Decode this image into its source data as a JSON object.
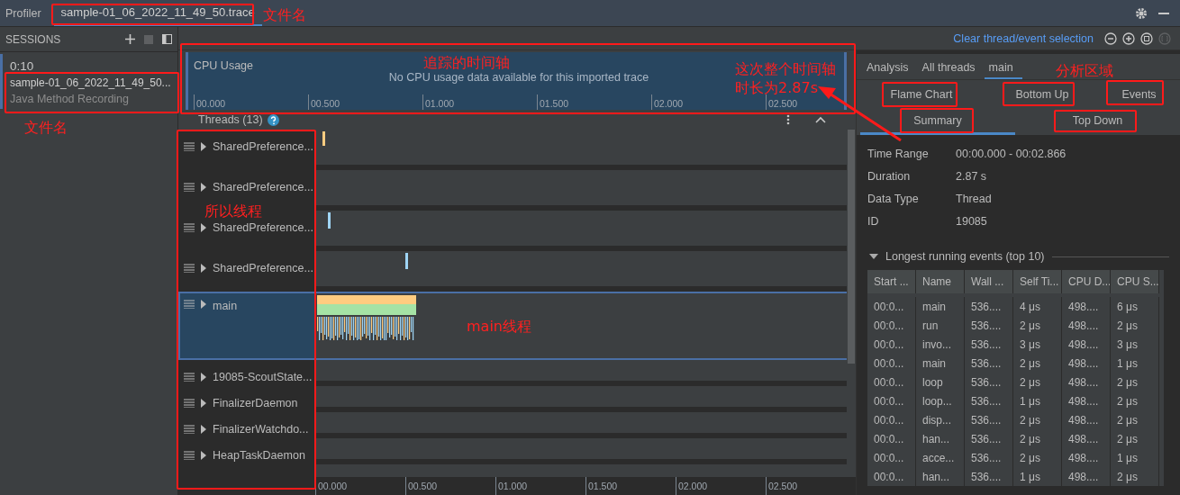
{
  "top_bar": {
    "title": "Profiler",
    "tabs": [
      {
        "label": "sample-01_06_2022_11_49_50.trace",
        "selected": true
      }
    ]
  },
  "sessions": {
    "title": "SESSIONS",
    "items": [
      {
        "time": "0:10",
        "name": "sample-01_06_2022_11_49_50...",
        "type": "Java Method Recording",
        "selected": true
      }
    ]
  },
  "toolbar": {
    "link": "Clear thread/event selection"
  },
  "cpu_usage": {
    "title": "CPU Usage",
    "message": "No CPU usage data available for this imported trace",
    "axis": [
      "00.000",
      "00.500",
      "01.000",
      "01.500",
      "02.000",
      "02.500"
    ]
  },
  "threads": {
    "title": "Threads (13)",
    "items": [
      {
        "name": "SharedPreference...",
        "selected": false
      },
      {
        "name": "SharedPreference...",
        "selected": false
      },
      {
        "name": "SharedPreference...",
        "selected": false
      },
      {
        "name": "SharedPreference...",
        "selected": false
      },
      {
        "name": "main",
        "selected": true
      },
      {
        "name": "19085-ScoutState...",
        "selected": false
      },
      {
        "name": "FinalizerDaemon",
        "selected": false
      },
      {
        "name": "FinalizerWatchdo...",
        "selected": false
      },
      {
        "name": "HeapTaskDaemon",
        "selected": false
      }
    ],
    "axis": [
      "00.000",
      "00.500",
      "01.000",
      "01.500",
      "02.000",
      "02.500"
    ]
  },
  "analysis": {
    "tabs": [
      {
        "label": "Analysis",
        "selected": false
      },
      {
        "label": "All threads",
        "selected": false
      },
      {
        "label": "main",
        "selected": true
      }
    ],
    "views": [
      {
        "label": "Flame Chart",
        "selected": false
      },
      {
        "label": "Bottom Up",
        "selected": false
      },
      {
        "label": "Events",
        "selected": false
      },
      {
        "label": "Summary",
        "selected": true
      },
      {
        "label": "Top Down",
        "selected": false
      }
    ],
    "summary": [
      {
        "label": "Time Range",
        "value": "00:00.000 - 00:02.866"
      },
      {
        "label": "Duration",
        "value": "2.87 s"
      },
      {
        "label": "Data Type",
        "value": "Thread"
      },
      {
        "label": "ID",
        "value": "19085"
      }
    ],
    "events": {
      "title": "Longest running events (top 10)",
      "expanded": true,
      "columns": [
        "Start ...",
        "Name",
        "Wall ...",
        "Self Ti...",
        "CPU D...",
        "CPU S..."
      ],
      "rows": [
        [
          "00:0...",
          "main",
          "536....",
          "4 μs",
          "498....",
          "6 μs"
        ],
        [
          "00:0...",
          "run",
          "536....",
          "2 μs",
          "498....",
          "2 μs"
        ],
        [
          "00:0...",
          "invo...",
          "536....",
          "3 μs",
          "498....",
          "3 μs"
        ],
        [
          "00:0...",
          "main",
          "536....",
          "2 μs",
          "498....",
          "1 μs"
        ],
        [
          "00:0...",
          "loop",
          "536....",
          "2 μs",
          "498....",
          "2 μs"
        ],
        [
          "00:0...",
          "loop...",
          "536....",
          "1 μs",
          "498....",
          "2 μs"
        ],
        [
          "00:0...",
          "disp...",
          "536....",
          "2 μs",
          "498....",
          "2 μs"
        ],
        [
          "00:0...",
          "han...",
          "536....",
          "2 μs",
          "498....",
          "2 μs"
        ],
        [
          "00:0...",
          "acce...",
          "536....",
          "2 μs",
          "498....",
          "1 μs"
        ],
        [
          "00:0...",
          "han...",
          "536....",
          "1 μs",
          "498....",
          "2 μs"
        ]
      ]
    }
  },
  "annotations": [
    {
      "kind": "label",
      "text": "文件名"
    },
    {
      "kind": "label",
      "text": "文件名"
    },
    {
      "kind": "label",
      "text": "追踪的时间轴"
    },
    {
      "kind": "label",
      "text": "这次整个时间轴时长为2.87s"
    },
    {
      "kind": "label",
      "text": "分析区域"
    },
    {
      "kind": "label",
      "text": "所以线程"
    },
    {
      "kind": "label",
      "text": "main线程"
    }
  ]
}
